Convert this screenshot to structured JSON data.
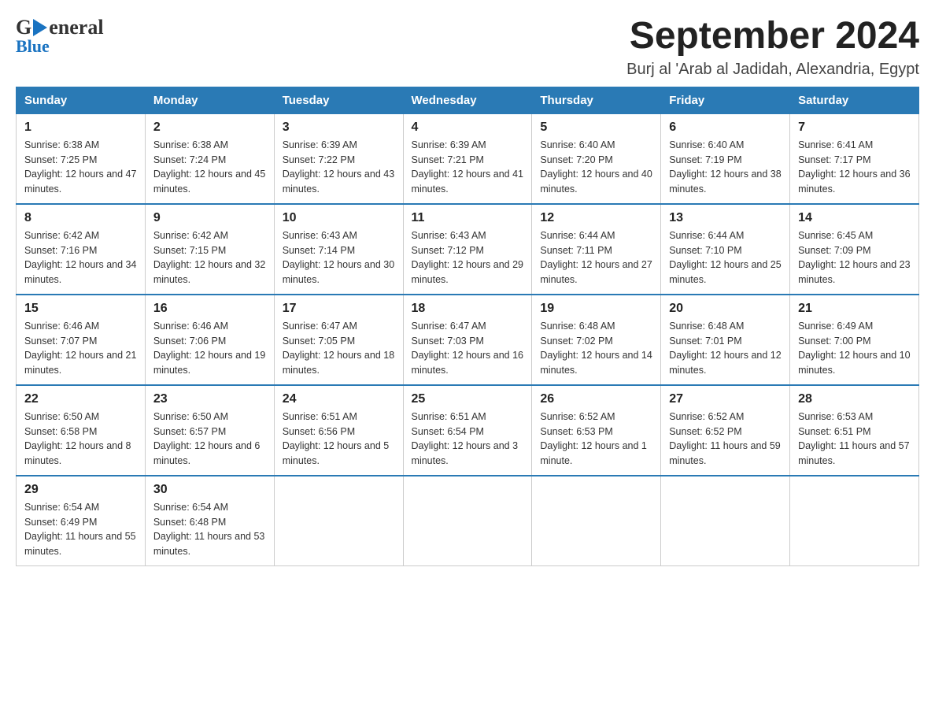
{
  "header": {
    "logo_general": "General",
    "logo_blue": "Blue",
    "month_title": "September 2024",
    "location": "Burj al 'Arab al Jadidah, Alexandria, Egypt"
  },
  "weekdays": [
    "Sunday",
    "Monday",
    "Tuesday",
    "Wednesday",
    "Thursday",
    "Friday",
    "Saturday"
  ],
  "weeks": [
    [
      {
        "day": "1",
        "sunrise": "Sunrise: 6:38 AM",
        "sunset": "Sunset: 7:25 PM",
        "daylight": "Daylight: 12 hours and 47 minutes."
      },
      {
        "day": "2",
        "sunrise": "Sunrise: 6:38 AM",
        "sunset": "Sunset: 7:24 PM",
        "daylight": "Daylight: 12 hours and 45 minutes."
      },
      {
        "day": "3",
        "sunrise": "Sunrise: 6:39 AM",
        "sunset": "Sunset: 7:22 PM",
        "daylight": "Daylight: 12 hours and 43 minutes."
      },
      {
        "day": "4",
        "sunrise": "Sunrise: 6:39 AM",
        "sunset": "Sunset: 7:21 PM",
        "daylight": "Daylight: 12 hours and 41 minutes."
      },
      {
        "day": "5",
        "sunrise": "Sunrise: 6:40 AM",
        "sunset": "Sunset: 7:20 PM",
        "daylight": "Daylight: 12 hours and 40 minutes."
      },
      {
        "day": "6",
        "sunrise": "Sunrise: 6:40 AM",
        "sunset": "Sunset: 7:19 PM",
        "daylight": "Daylight: 12 hours and 38 minutes."
      },
      {
        "day": "7",
        "sunrise": "Sunrise: 6:41 AM",
        "sunset": "Sunset: 7:17 PM",
        "daylight": "Daylight: 12 hours and 36 minutes."
      }
    ],
    [
      {
        "day": "8",
        "sunrise": "Sunrise: 6:42 AM",
        "sunset": "Sunset: 7:16 PM",
        "daylight": "Daylight: 12 hours and 34 minutes."
      },
      {
        "day": "9",
        "sunrise": "Sunrise: 6:42 AM",
        "sunset": "Sunset: 7:15 PM",
        "daylight": "Daylight: 12 hours and 32 minutes."
      },
      {
        "day": "10",
        "sunrise": "Sunrise: 6:43 AM",
        "sunset": "Sunset: 7:14 PM",
        "daylight": "Daylight: 12 hours and 30 minutes."
      },
      {
        "day": "11",
        "sunrise": "Sunrise: 6:43 AM",
        "sunset": "Sunset: 7:12 PM",
        "daylight": "Daylight: 12 hours and 29 minutes."
      },
      {
        "day": "12",
        "sunrise": "Sunrise: 6:44 AM",
        "sunset": "Sunset: 7:11 PM",
        "daylight": "Daylight: 12 hours and 27 minutes."
      },
      {
        "day": "13",
        "sunrise": "Sunrise: 6:44 AM",
        "sunset": "Sunset: 7:10 PM",
        "daylight": "Daylight: 12 hours and 25 minutes."
      },
      {
        "day": "14",
        "sunrise": "Sunrise: 6:45 AM",
        "sunset": "Sunset: 7:09 PM",
        "daylight": "Daylight: 12 hours and 23 minutes."
      }
    ],
    [
      {
        "day": "15",
        "sunrise": "Sunrise: 6:46 AM",
        "sunset": "Sunset: 7:07 PM",
        "daylight": "Daylight: 12 hours and 21 minutes."
      },
      {
        "day": "16",
        "sunrise": "Sunrise: 6:46 AM",
        "sunset": "Sunset: 7:06 PM",
        "daylight": "Daylight: 12 hours and 19 minutes."
      },
      {
        "day": "17",
        "sunrise": "Sunrise: 6:47 AM",
        "sunset": "Sunset: 7:05 PM",
        "daylight": "Daylight: 12 hours and 18 minutes."
      },
      {
        "day": "18",
        "sunrise": "Sunrise: 6:47 AM",
        "sunset": "Sunset: 7:03 PM",
        "daylight": "Daylight: 12 hours and 16 minutes."
      },
      {
        "day": "19",
        "sunrise": "Sunrise: 6:48 AM",
        "sunset": "Sunset: 7:02 PM",
        "daylight": "Daylight: 12 hours and 14 minutes."
      },
      {
        "day": "20",
        "sunrise": "Sunrise: 6:48 AM",
        "sunset": "Sunset: 7:01 PM",
        "daylight": "Daylight: 12 hours and 12 minutes."
      },
      {
        "day": "21",
        "sunrise": "Sunrise: 6:49 AM",
        "sunset": "Sunset: 7:00 PM",
        "daylight": "Daylight: 12 hours and 10 minutes."
      }
    ],
    [
      {
        "day": "22",
        "sunrise": "Sunrise: 6:50 AM",
        "sunset": "Sunset: 6:58 PM",
        "daylight": "Daylight: 12 hours and 8 minutes."
      },
      {
        "day": "23",
        "sunrise": "Sunrise: 6:50 AM",
        "sunset": "Sunset: 6:57 PM",
        "daylight": "Daylight: 12 hours and 6 minutes."
      },
      {
        "day": "24",
        "sunrise": "Sunrise: 6:51 AM",
        "sunset": "Sunset: 6:56 PM",
        "daylight": "Daylight: 12 hours and 5 minutes."
      },
      {
        "day": "25",
        "sunrise": "Sunrise: 6:51 AM",
        "sunset": "Sunset: 6:54 PM",
        "daylight": "Daylight: 12 hours and 3 minutes."
      },
      {
        "day": "26",
        "sunrise": "Sunrise: 6:52 AM",
        "sunset": "Sunset: 6:53 PM",
        "daylight": "Daylight: 12 hours and 1 minute."
      },
      {
        "day": "27",
        "sunrise": "Sunrise: 6:52 AM",
        "sunset": "Sunset: 6:52 PM",
        "daylight": "Daylight: 11 hours and 59 minutes."
      },
      {
        "day": "28",
        "sunrise": "Sunrise: 6:53 AM",
        "sunset": "Sunset: 6:51 PM",
        "daylight": "Daylight: 11 hours and 57 minutes."
      }
    ],
    [
      {
        "day": "29",
        "sunrise": "Sunrise: 6:54 AM",
        "sunset": "Sunset: 6:49 PM",
        "daylight": "Daylight: 11 hours and 55 minutes."
      },
      {
        "day": "30",
        "sunrise": "Sunrise: 6:54 AM",
        "sunset": "Sunset: 6:48 PM",
        "daylight": "Daylight: 11 hours and 53 minutes."
      },
      null,
      null,
      null,
      null,
      null
    ]
  ]
}
